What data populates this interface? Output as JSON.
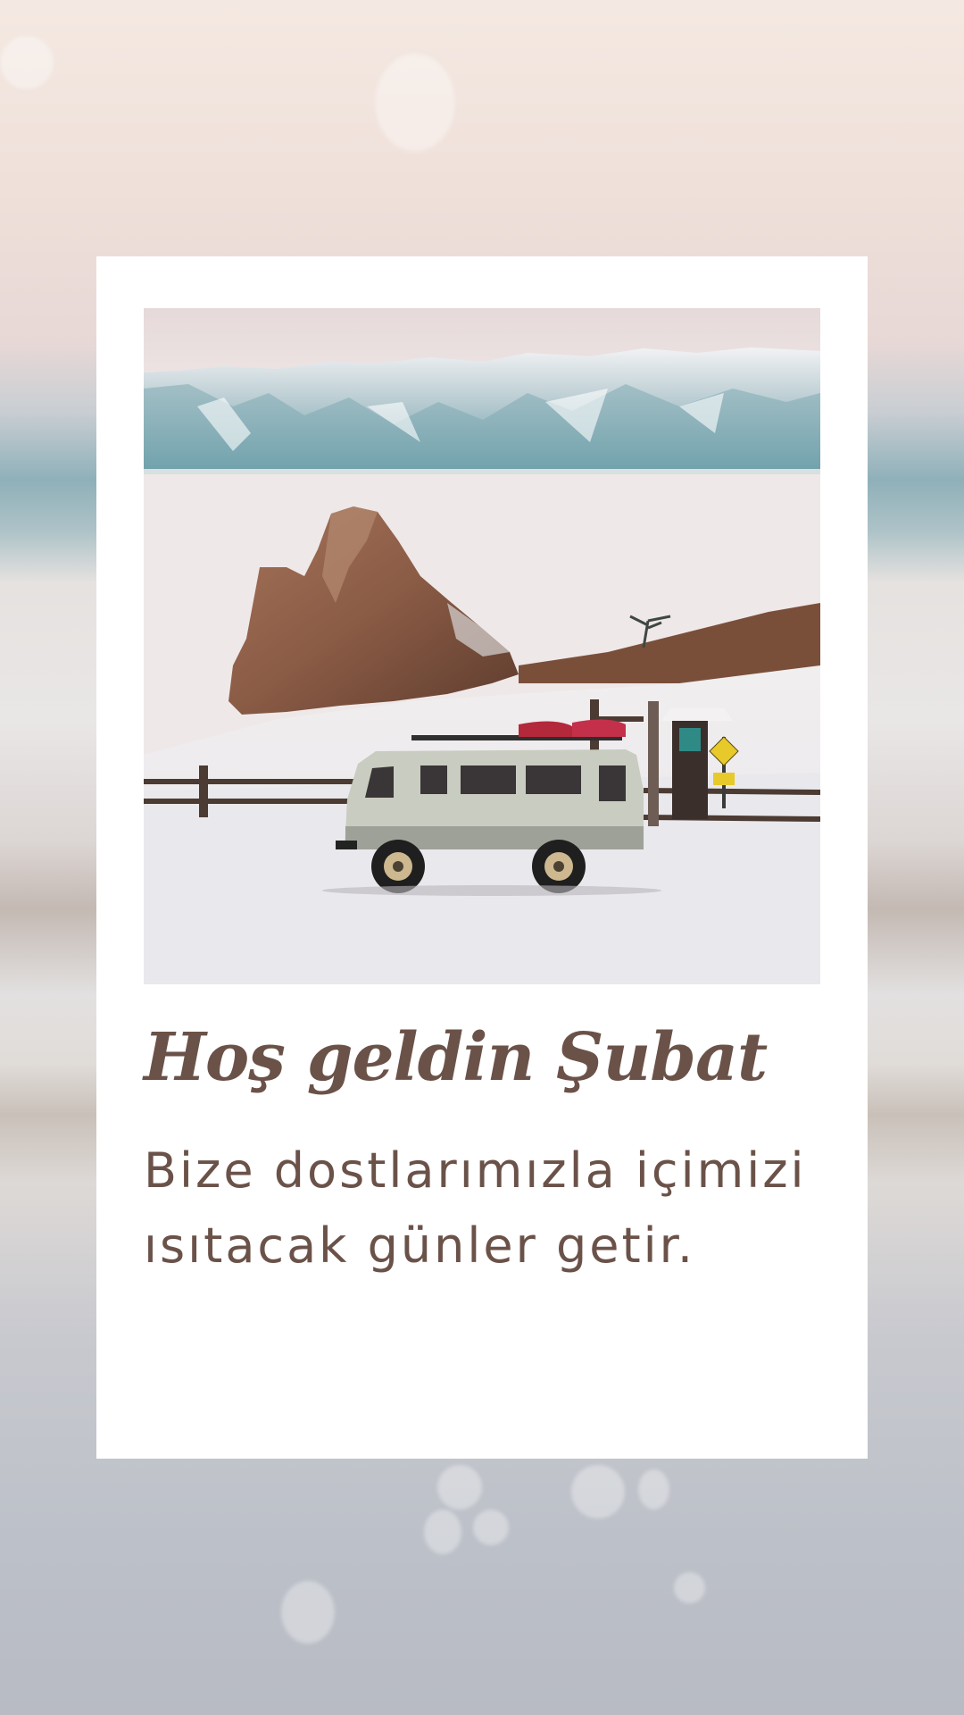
{
  "card": {
    "title": "Hoş geldin Şubat",
    "subtitle": "Bize dostlarımızla içimizi ısıtacak günler getir."
  },
  "photo": {
    "sign_icon": "warning-sign-icon"
  },
  "colors": {
    "text": "#6b5249",
    "card": "#ffffff"
  }
}
